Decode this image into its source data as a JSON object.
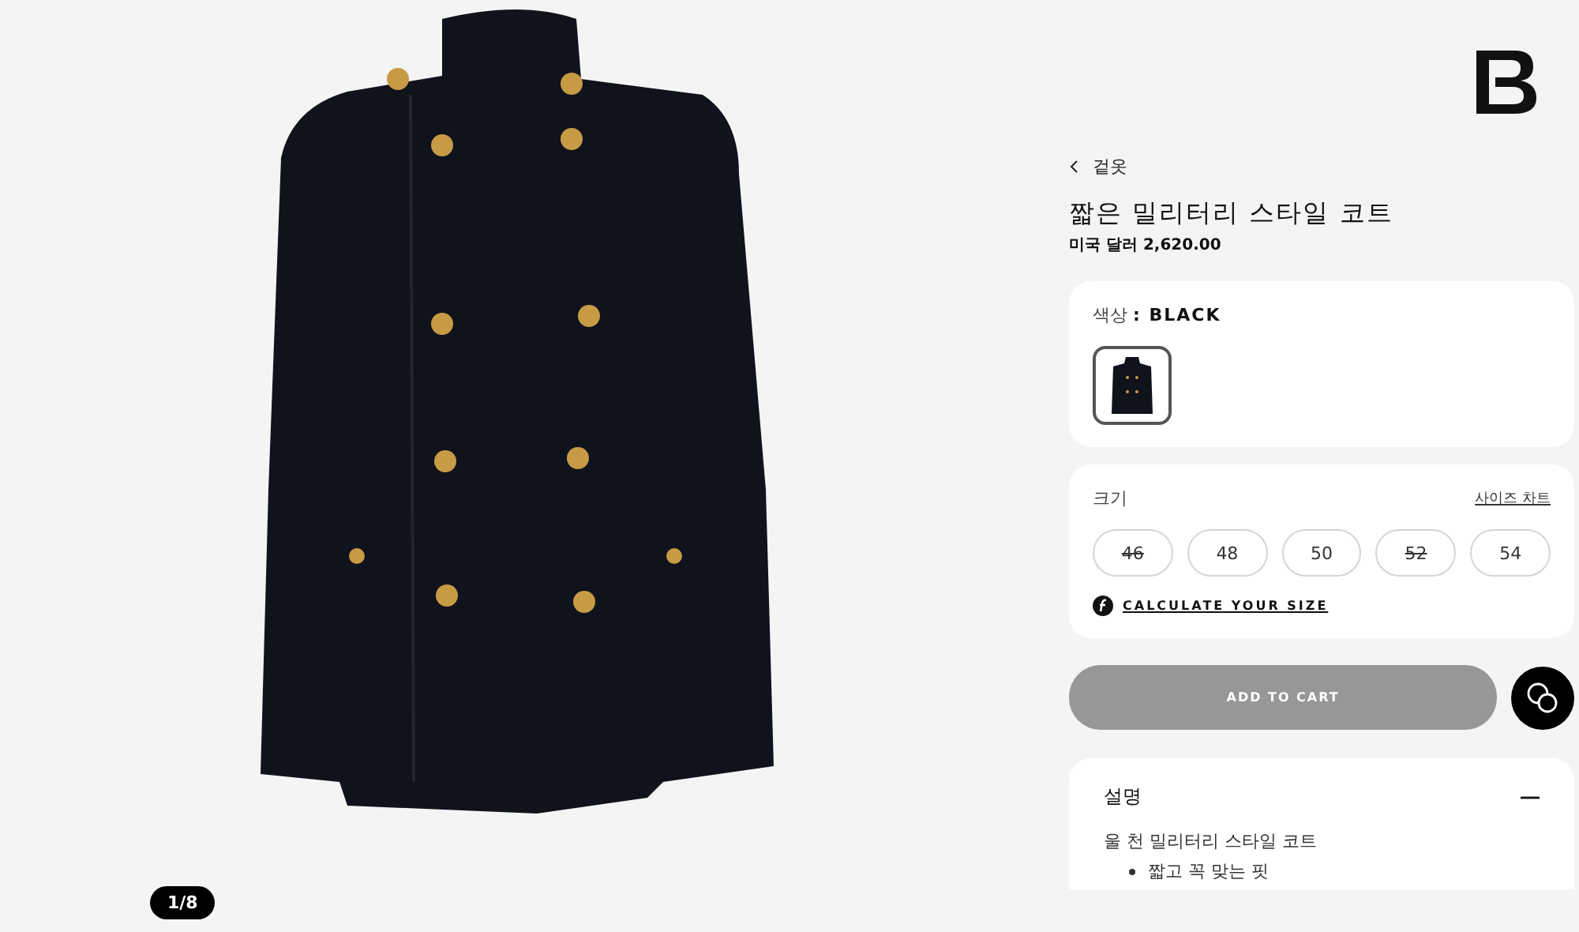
{
  "gallery": {
    "counter": "1/8"
  },
  "breadcrumb": {
    "label": "겉옷"
  },
  "product": {
    "title": "짧은 밀리터리 스타일 코트",
    "price": "미국 달러 2,620.00"
  },
  "color": {
    "label": "색상",
    "value": ": BLACK",
    "swatches": [
      {
        "selected": true
      }
    ]
  },
  "size": {
    "label": "크기",
    "chart_link": "사이즈 차트",
    "options": [
      {
        "label": "46",
        "available": false
      },
      {
        "label": "48",
        "available": true
      },
      {
        "label": "50",
        "available": true
      },
      {
        "label": "52",
        "available": false
      },
      {
        "label": "54",
        "available": true
      }
    ],
    "calculator": "CALCULATE YOUR SIZE"
  },
  "add_to_cart": {
    "label": "ADD TO CART",
    "disabled": true
  },
  "description": {
    "title": "설명",
    "expanded": true,
    "summary": "울 천 밀리터리 스타일 코트",
    "bullets": [
      "짧고 꼭 맞는 핏"
    ]
  }
}
